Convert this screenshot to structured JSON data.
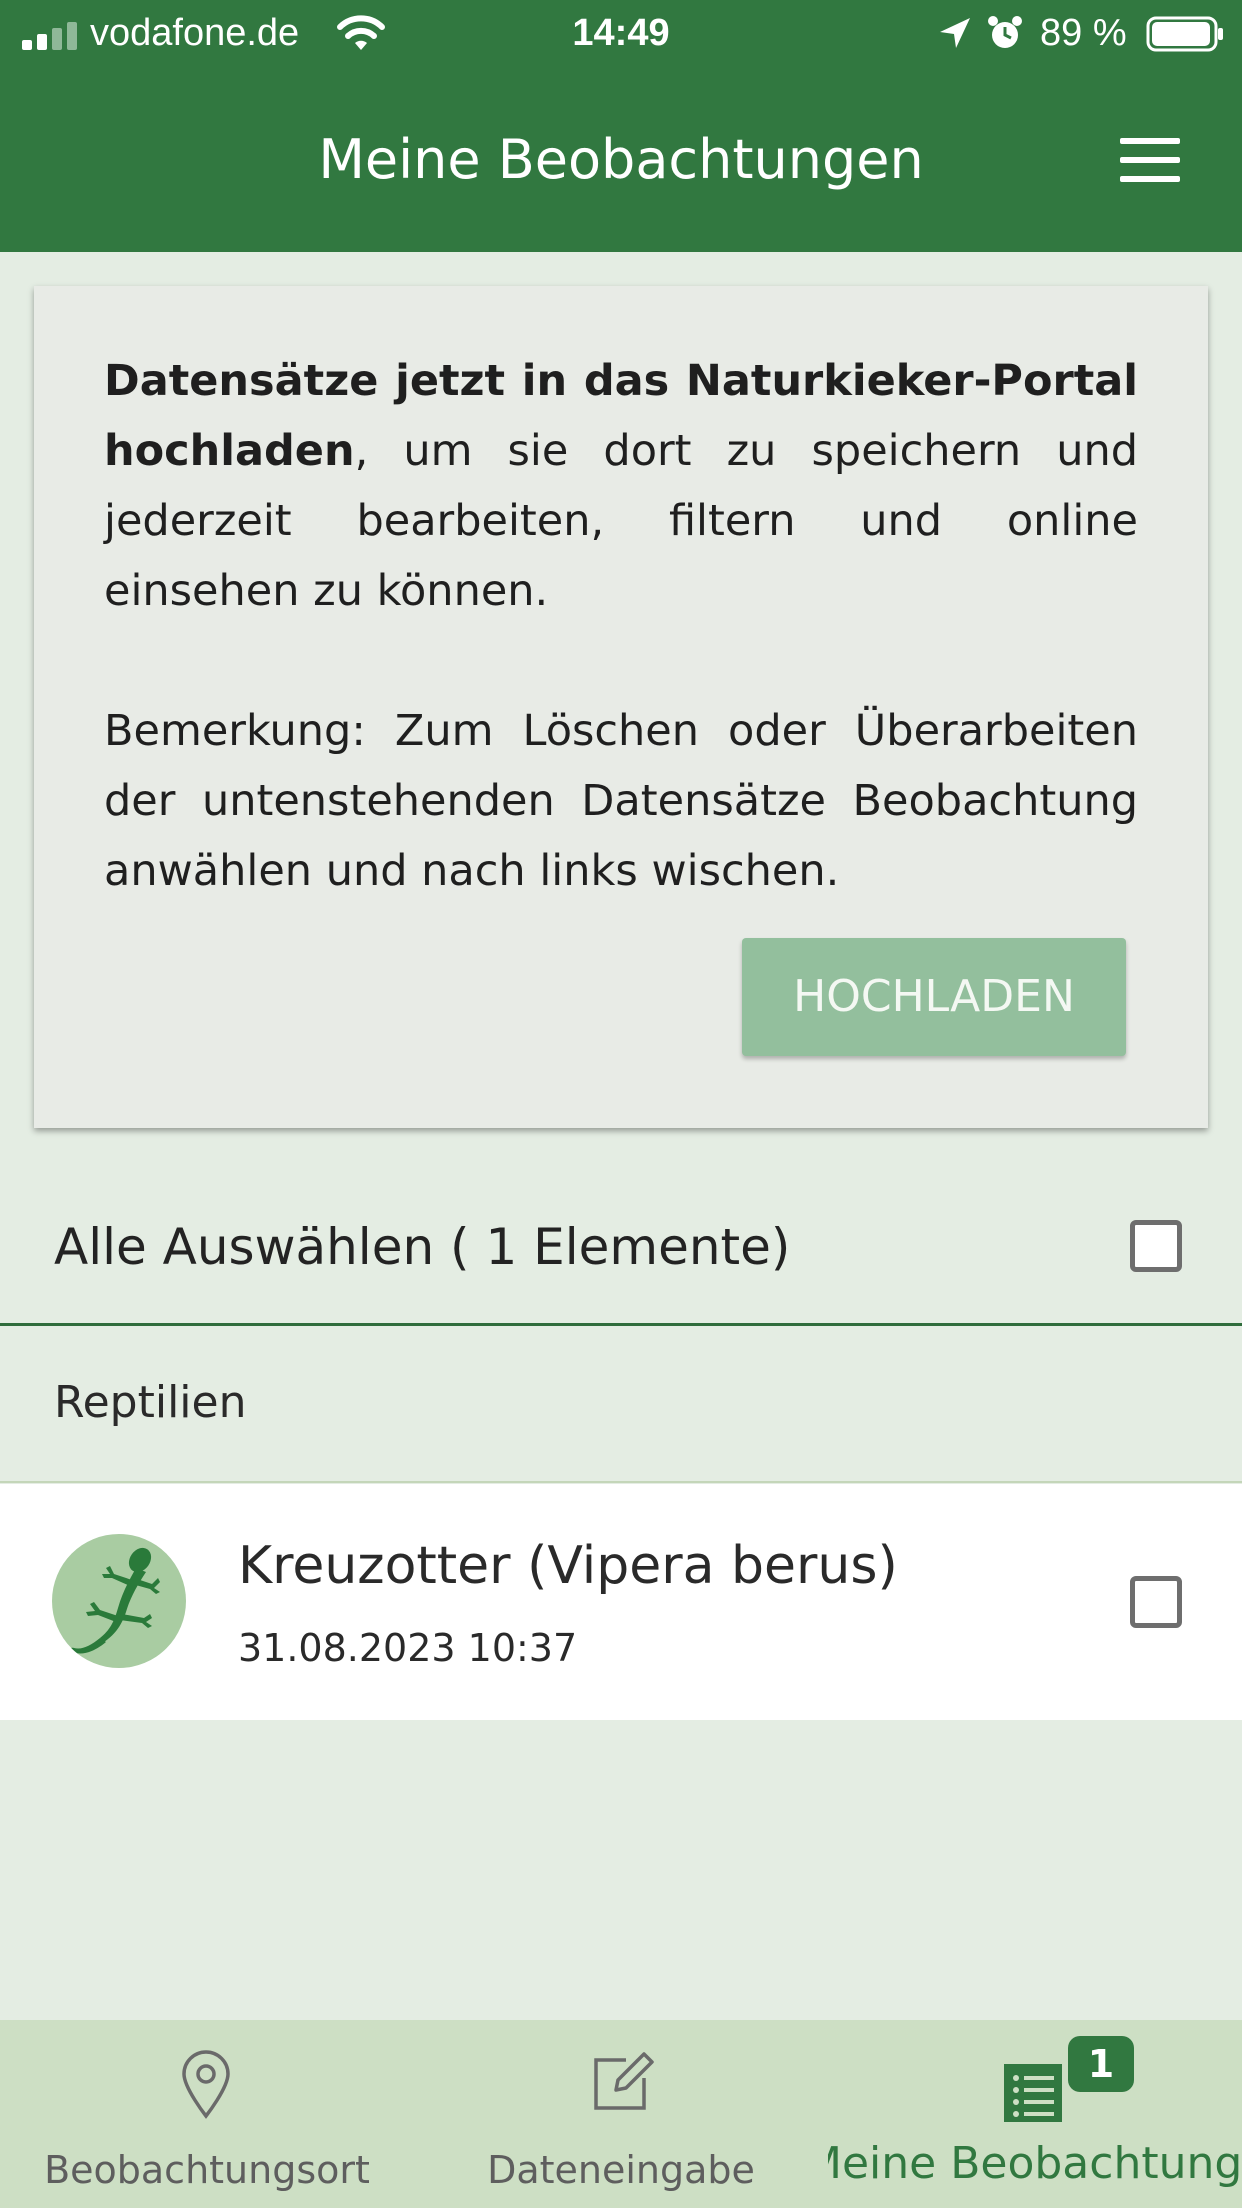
{
  "status_bar": {
    "carrier": "vodafone.de",
    "time": "14:49",
    "battery": "89 %"
  },
  "header": {
    "title": "Meine Beobachtungen"
  },
  "card": {
    "text_bold": "Datensätze jetzt in das Naturkieker-Portal hochladen",
    "text_rest": ", um sie dort zu speichern und jederzeit bearbeiten, filtern und online einsehen zu können.",
    "note": "Bemerkung: Zum Löschen oder Überarbeiten der untenstehenden Datensätze Beobachtung anwählen und nach links wischen.",
    "upload_label": "HOCHLADEN"
  },
  "select_all": {
    "label": "Alle Auswählen ( 1 Elemente)",
    "checked": false
  },
  "groups": [
    {
      "label": "Reptilien",
      "items": [
        {
          "title": "Kreuzotter (Vipera berus)",
          "date": "31.08.2023 10:37",
          "icon": "lizard-icon",
          "checked": false
        }
      ]
    }
  ],
  "tabbar": {
    "tabs": [
      {
        "label": "Beobachtungsort",
        "icon": "map-pin-icon",
        "active": false
      },
      {
        "label": "Dateneingabe",
        "icon": "edit-icon",
        "active": false
      },
      {
        "label": "Meine Beobachtung...",
        "icon": "list-icon",
        "active": true,
        "badge": "1"
      }
    ]
  },
  "colors": {
    "brand_green": "#317840",
    "background": "#e4ede3",
    "tabbar_bg": "#cddfc4",
    "button_disabled": "#93bf9d"
  }
}
